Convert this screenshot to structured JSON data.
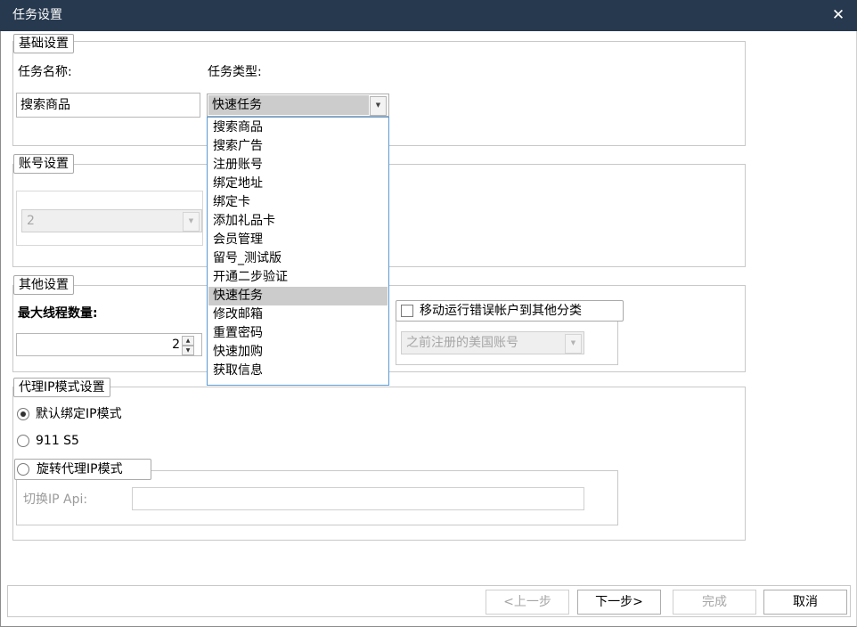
{
  "window": {
    "title": "任务设置",
    "close_glyph": "✕"
  },
  "basic": {
    "legend": "基础设置",
    "task_name_label": "任务名称:",
    "task_type_label": "任务类型:",
    "task_name_value": "搜索商品",
    "task_type_value": "快速任务"
  },
  "dropdown": {
    "options": [
      "搜索商品",
      "搜索广告",
      "注册账号",
      "绑定地址",
      "绑定卡",
      "添加礼品卡",
      "会员管理",
      "留号_测试版",
      "开通二步验证",
      "快速任务",
      "修改邮箱",
      "重置密码",
      "快速加购",
      "获取信息"
    ],
    "selected_index": 9
  },
  "account": {
    "legend": "账号设置",
    "combo_value": "2"
  },
  "other": {
    "legend": "其他设置",
    "max_threads_label": "最大线程数量:",
    "max_threads_value": "2",
    "move_error_label": "移动运行错误帐户到其他分类",
    "category_value": "之前注册的美国账号"
  },
  "proxy": {
    "legend": "代理IP模式设置",
    "default_mode_label": "默认绑定IP模式",
    "s5_label": "911 S5",
    "rotate_mode_label": "旋转代理IP模式",
    "switch_api_label": "切换IP Api:",
    "switch_api_value": ""
  },
  "footer": {
    "prev": "<上一步",
    "next": "下一步>",
    "finish": "完成",
    "cancel": "取消"
  },
  "icons": {
    "dropdown_arrow": "▼",
    "spin_up": "▲",
    "spin_down": "▼"
  }
}
